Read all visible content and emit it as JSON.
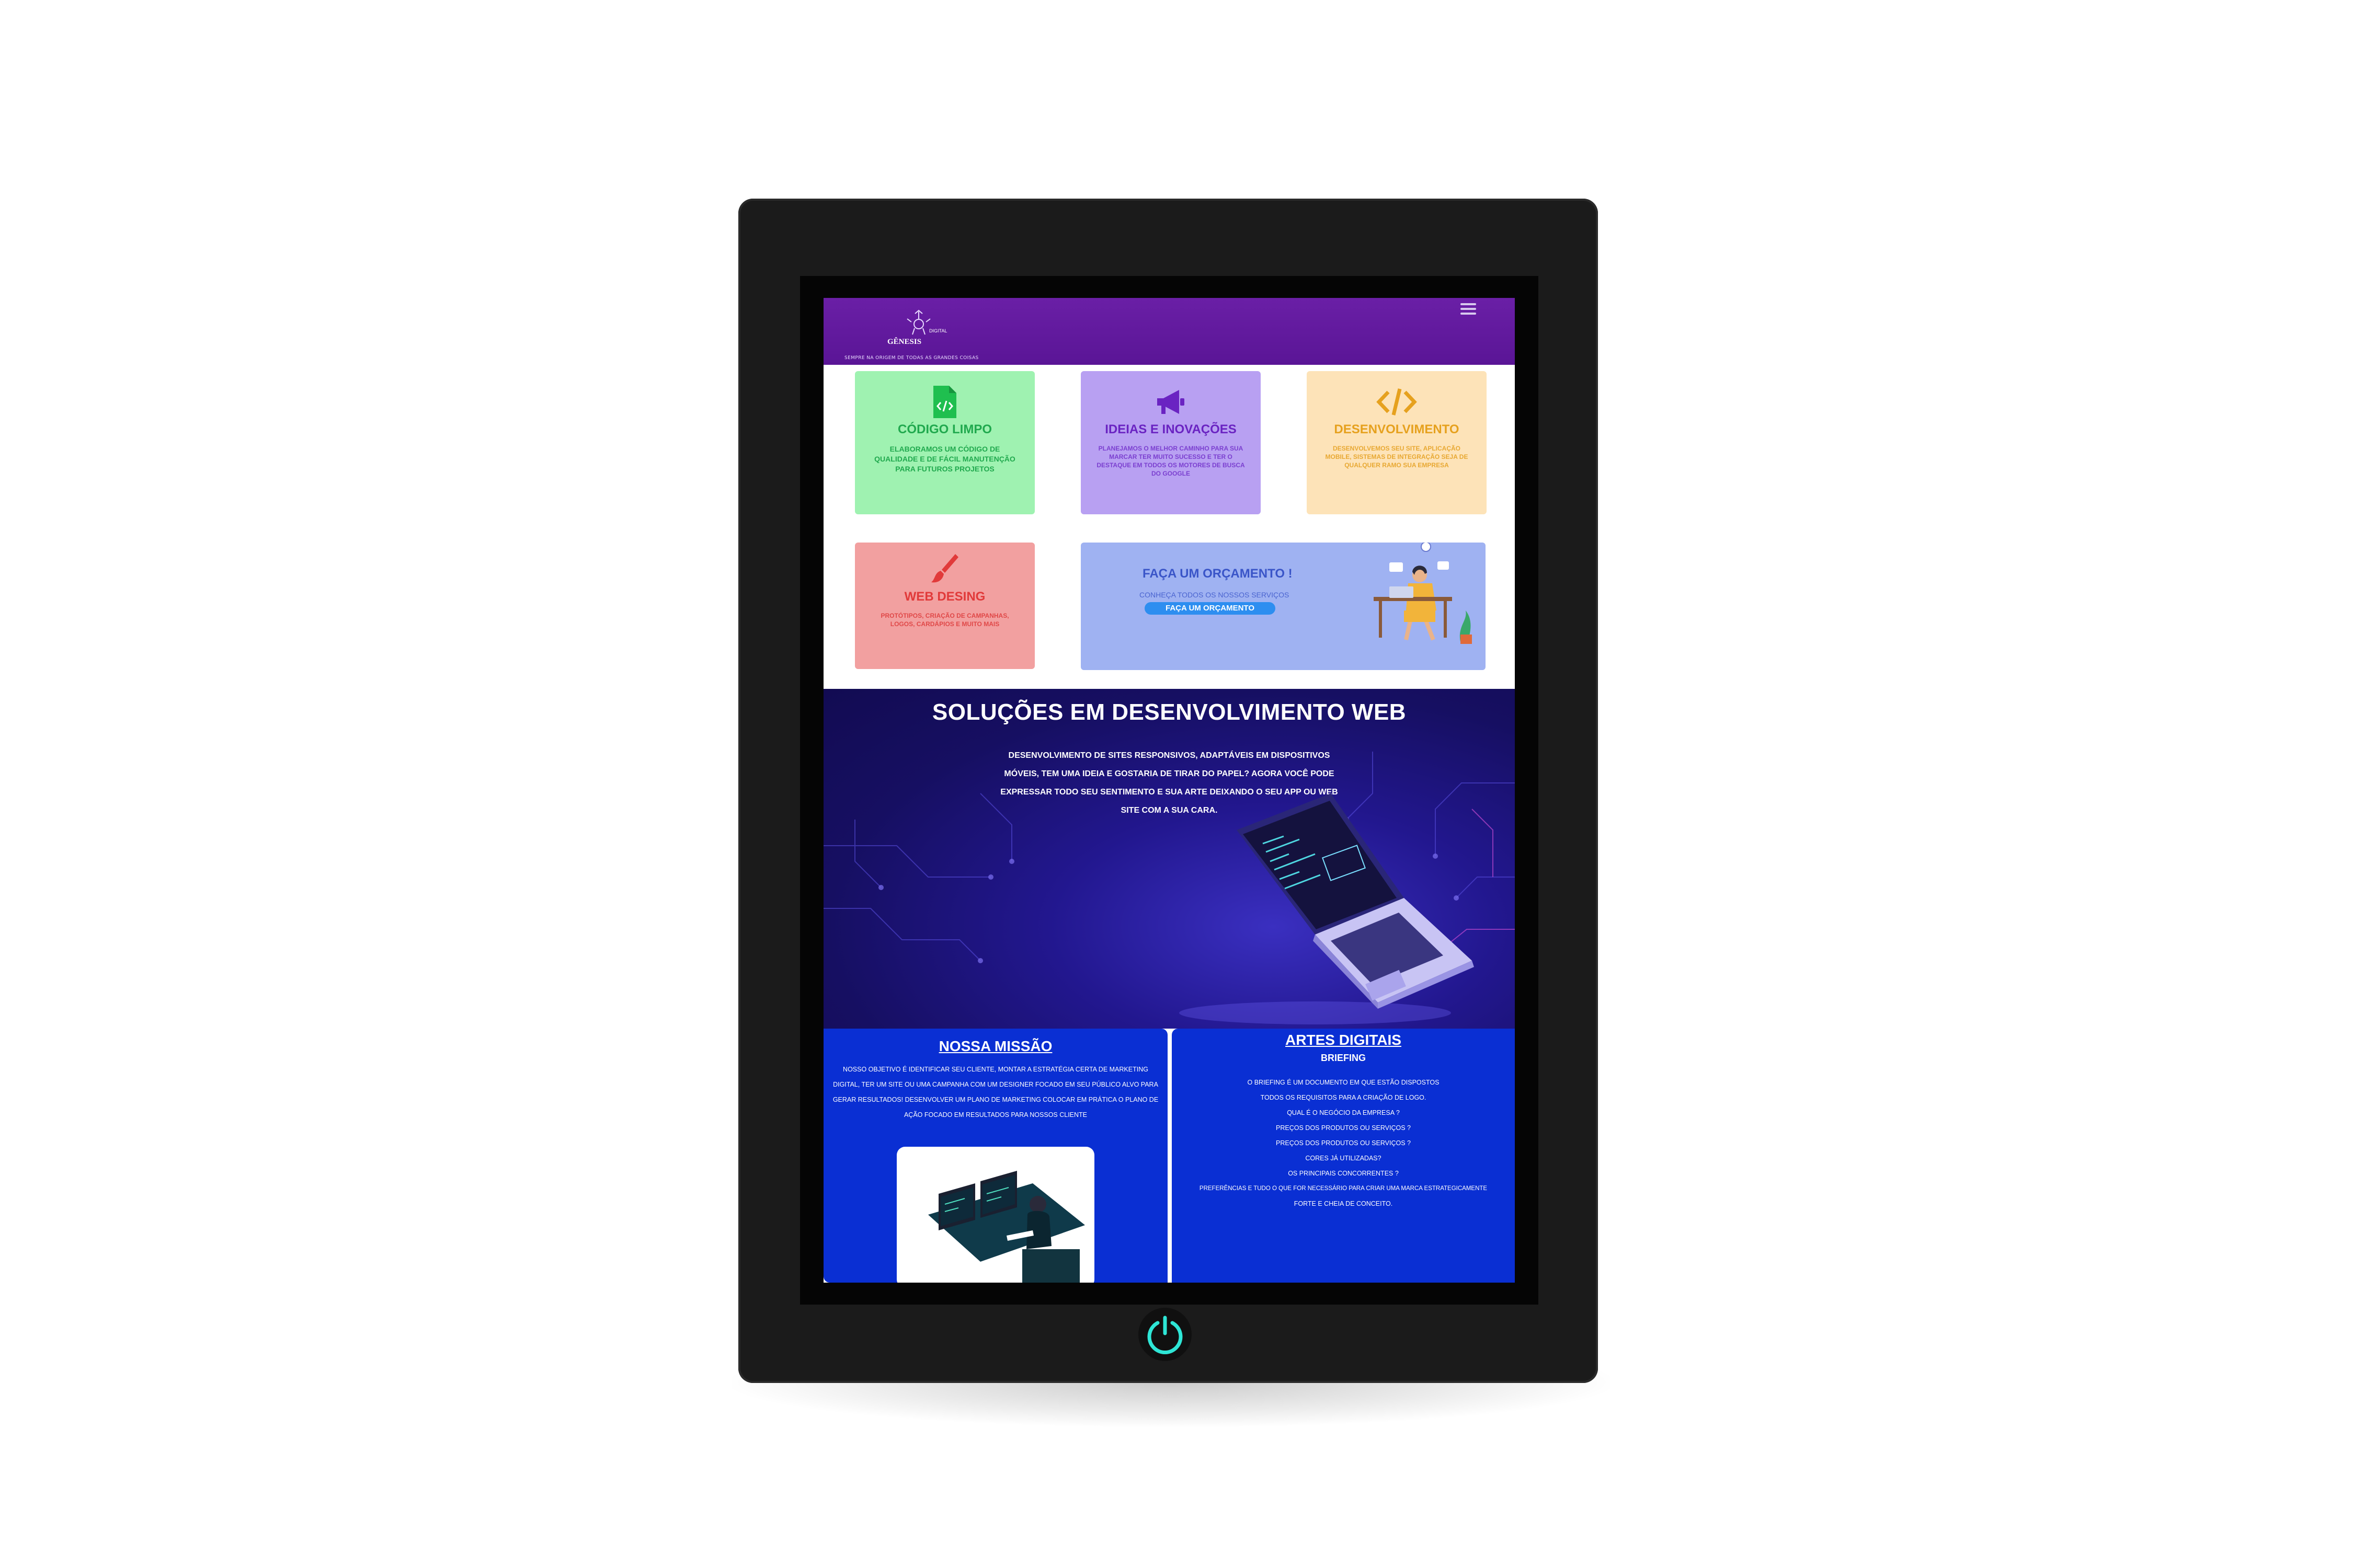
{
  "header": {
    "logo_text": "GÊNESIS",
    "logo_tag": "DIGITAL",
    "tagline": "SEMPRE NA ORIGEM DE TODAS AS GRANDES COISAS",
    "menu_icon": "hamburger-icon"
  },
  "cards": [
    {
      "icon": "file-code-icon",
      "title": "CÓDIGO LIMPO",
      "text": "ELABORAMOS UM CÓDIGO DE QUALIDADE E DE FÁCIL MANUTENÇÃO PARA FUTUROS PROJETOS",
      "color": "#9ff2b1"
    },
    {
      "icon": "megaphone-icon",
      "title": "IDEIAS E INOVAÇÕES",
      "text": "PLANEJAMOS O MELHOR CAMINHO PARA SUA MARCAR TER MUITO SUCESSO E TER O DESTAQUE EM TODOS OS MOTORES DE BUSCA DO GOOGLE",
      "color": "#b8a0f2"
    },
    {
      "icon": "code-icon",
      "title": "DESENVOLVIMENTO",
      "text": "DESENVOLVEMOS SEU SITE, APLICAÇÃO MOBILE, SISTEMAS DE INTEGRAÇÃO SEJA DE QUALQUER RAMO SUA EMPRESA",
      "color": "#fde3b8"
    },
    {
      "icon": "brush-icon",
      "title": "WEB DESING",
      "text": "PROTÓTIPOS, CRIAÇÃO DE CAMPANHAS, LOGOS, CARDÁPIOS E MUITO MAIS",
      "color": "#f2a0a0"
    }
  ],
  "quote": {
    "title": "FAÇA UM ORÇAMENTO !",
    "subtitle": "CONHEÇA TODOS OS NOSSOS SERVIÇOS",
    "button": "FAÇA UM ORÇAMENTO"
  },
  "hero": {
    "title": "SOLUÇÕES EM DESENVOLVIMENTO WEB",
    "text": "DESENVOLVIMENTO DE SITES RESPONSIVOS, ADAPTÁVEIS EM DISPOSITIVOS MÓVEIS, TEM UMA IDEIA E GOSTARIA DE TIRAR DO PAPEL? AGORA VOCÊ PODE EXPRESSAR TODO SEU SENTIMENTO E SUA ARTE DEIXANDO O SEU APP OU WEB SITE COM A SUA CARA."
  },
  "mission": {
    "title": "NOSSA MISSÃO",
    "text": "NOSSO OBJETIVO É IDENTIFICAR SEU CLIENTE, MONTAR A ESTRATÉGIA CERTA DE MARKETING DIGITAL, TER UM SITE OU UMA CAMPANHA COM UM DESIGNER FOCADO EM SEU PÚBLICO ALVO PARA GERAR RESULTADOS! DESENVOLVER UM PLANO DE MARKETING COLOCAR EM PRÁTICA O PLANO DE AÇÃO FOCADO EM RESULTADOS PARA NOSSOS CLIENTE"
  },
  "arts": {
    "title": "ARTES DIGITAIS",
    "subtitle": "BRIEFING",
    "lines": [
      "O BRIEFING É UM DOCUMENTO EM QUE ESTÃO DISPOSTOS",
      "TODOS OS REQUISITOS PARA A CRIAÇÃO DE LOGO.",
      "QUAL É O NEGÓCIO DA EMPRESA ?",
      "PREÇOS DOS PRODUTOS OU SERVIÇOS ?",
      "PREÇOS DOS PRODUTOS OU SERVIÇOS ?",
      "CORES JÁ UTILIZADAS?",
      "OS PRINCIPAIS CONCORRENTES ?",
      "PREFERÊNCIAS E TUDO O QUE FOR NECESSÁRIO PARA CRIAR UMA MARCA ESTRATEGICAMENTE",
      "FORTE E CHEIA DE CONCEITO."
    ]
  },
  "device": {
    "power_icon": "power-icon",
    "power_color": "#2ee6d6"
  }
}
